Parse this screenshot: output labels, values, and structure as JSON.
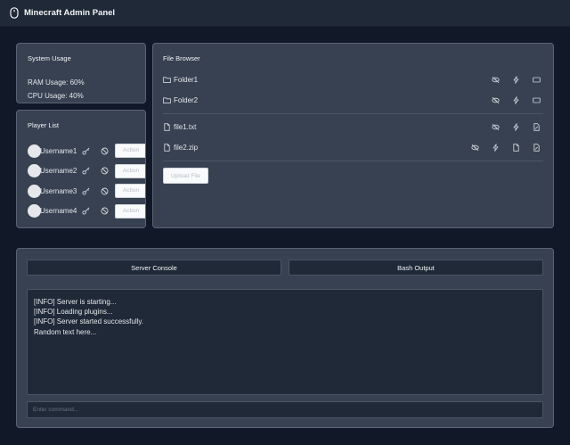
{
  "header": {
    "title": "Minecraft Admin Panel",
    "logo_icon": "mouse-icon"
  },
  "system_usage": {
    "title": "System Usage",
    "ram": "RAM Usage: 60%",
    "cpu": "CPU Usage: 40%"
  },
  "player_list": {
    "title": "Player List",
    "players": [
      {
        "name": "Username1",
        "action_label": "Action"
      },
      {
        "name": "Username2",
        "action_label": "Action"
      },
      {
        "name": "Username3",
        "action_label": "Action"
      },
      {
        "name": "Username4",
        "action_label": "Action"
      }
    ]
  },
  "file_browser": {
    "title": "File Browser",
    "folders": [
      {
        "name": "Folder1"
      },
      {
        "name": "Folder2"
      }
    ],
    "files": [
      {
        "name": "file1.txt"
      },
      {
        "name": "file2.zip"
      }
    ],
    "upload_label": "Upload File"
  },
  "console": {
    "tabs": [
      {
        "label": "Server Console"
      },
      {
        "label": "Bash Output"
      }
    ],
    "output_lines": [
      "[INFO] Server is starting...",
      "[INFO] Loading plugins...",
      "[INFO] Server started successfully.",
      "Random text here..."
    ],
    "command_placeholder": "Enter command..."
  },
  "colors": {
    "background": "#111827",
    "panel": "#374151",
    "header": "#1f2937"
  }
}
